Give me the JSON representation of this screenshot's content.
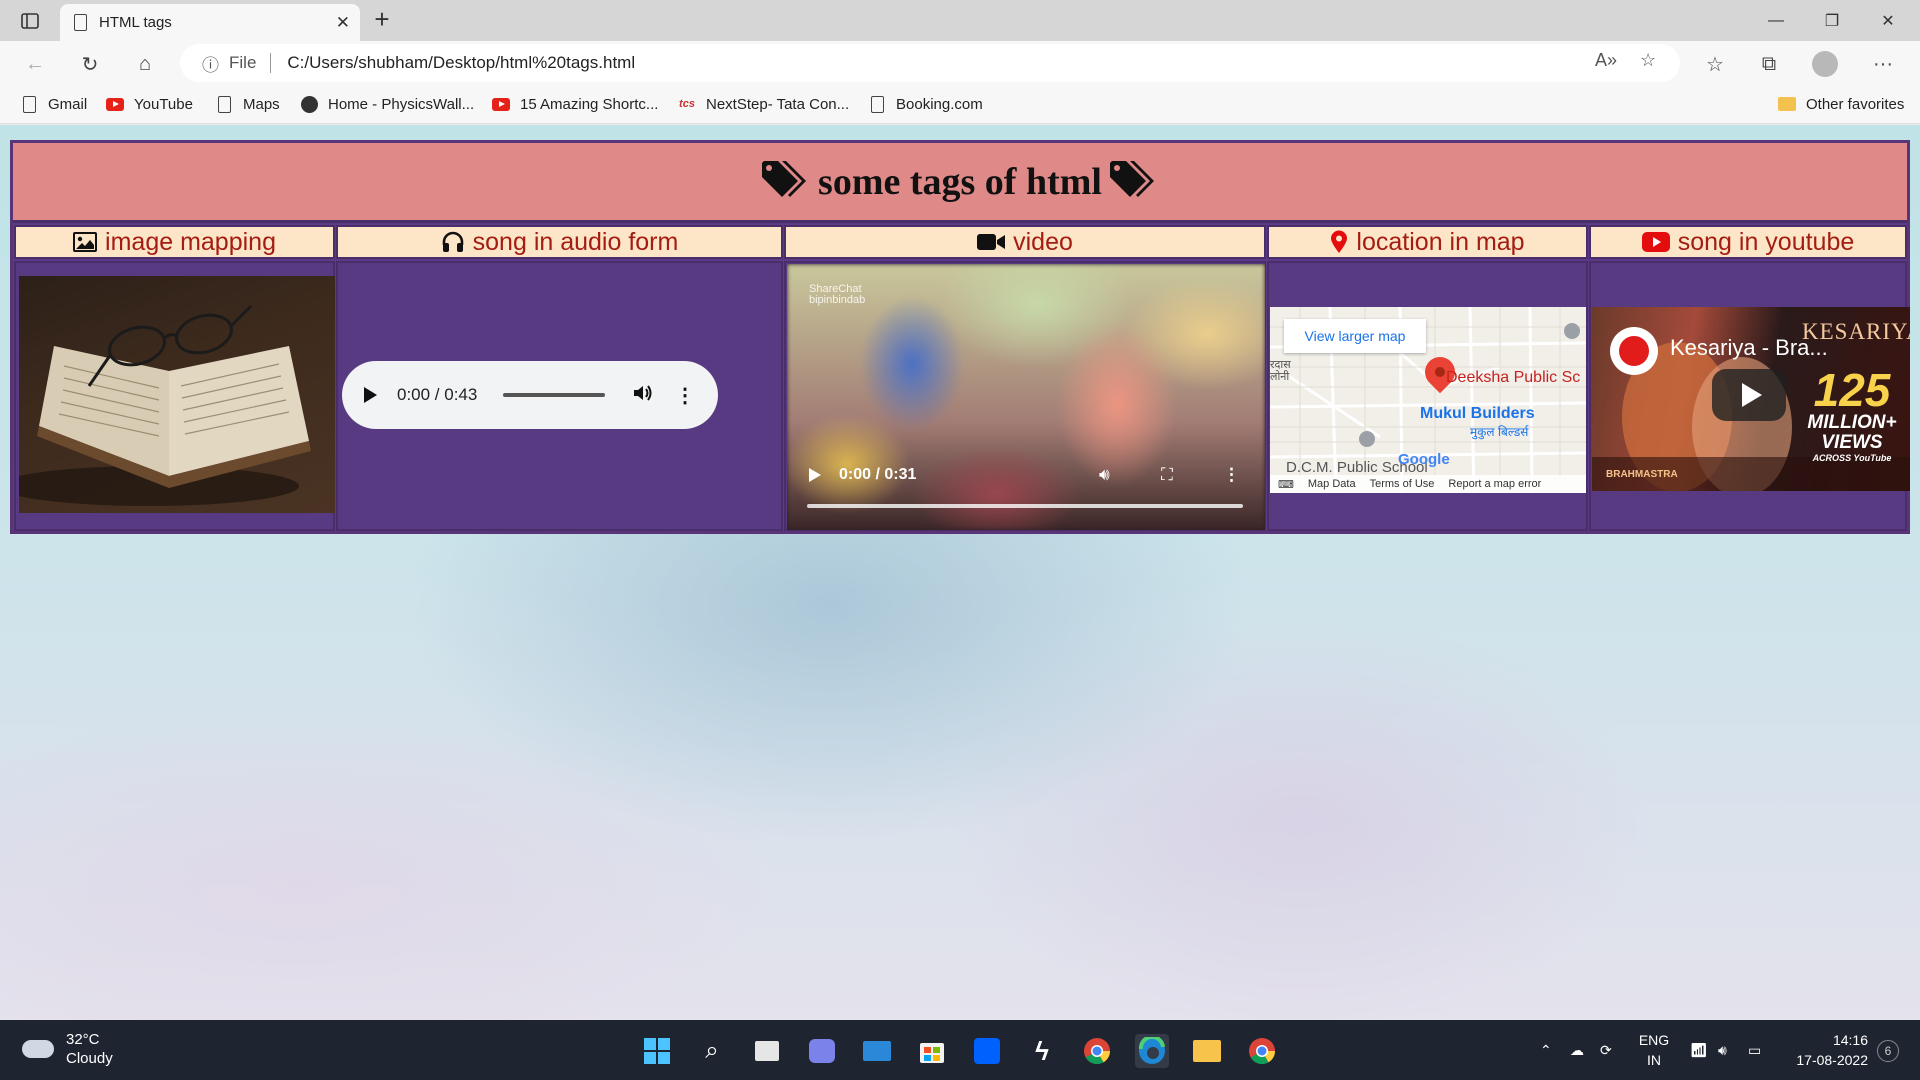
{
  "browser": {
    "tab_title": "HTML tags",
    "file_label": "File",
    "url": "C:/Users/shubham/Desktop/html%20tags.html",
    "favorites": [
      {
        "label": "Gmail",
        "icon": "page-icon"
      },
      {
        "label": "YouTube",
        "icon": "youtube-icon"
      },
      {
        "label": "Maps",
        "icon": "page-icon"
      },
      {
        "label": "Home - PhysicsWall...",
        "icon": "physicswallah-icon"
      },
      {
        "label": "15 Amazing Shortc...",
        "icon": "youtube-icon"
      },
      {
        "label": "NextStep- Tata Con...",
        "icon": "tcs-icon"
      },
      {
        "label": "Booking.com",
        "icon": "page-icon"
      }
    ],
    "other_favorites": "Other favorites"
  },
  "page": {
    "title": "some tags of html",
    "headers": [
      {
        "label": "image mapping",
        "icon": "image-icon"
      },
      {
        "label": "song in audio form",
        "icon": "headphones-icon"
      },
      {
        "label": "video",
        "icon": "video-camera-icon"
      },
      {
        "label": "location in map",
        "icon": "map-marker-icon"
      },
      {
        "label": "song in youtube",
        "icon": "youtube-icon"
      }
    ],
    "audio": {
      "time": "0:00 / 0:43"
    },
    "video": {
      "time": "0:00 / 0:31",
      "watermark": "ShareChat",
      "watermark_user": "bipinbindab"
    },
    "map": {
      "view_larger": "View larger map",
      "labels": [
        "Deeksha Public Sc",
        "Mukul Builders",
        "मुकुल बिल्डर्स",
        "D.C.M. Public School",
        "रदास",
        "लोनी"
      ],
      "footer": [
        "Map Data",
        "Terms of Use",
        "Report a map error"
      ],
      "brand": "Google"
    },
    "youtube": {
      "title": "Kesariya - Bra...",
      "overlay_title": "KESARIYA",
      "views_number": "125",
      "views_text": "MILLION+ VIEWS",
      "across": "ACROSS",
      "platform": "YouTube",
      "film": "BRAHMASTRA"
    }
  },
  "taskbar": {
    "weather_temp": "32°C",
    "weather_desc": "Cloudy",
    "lang_1": "ENG",
    "lang_2": "IN",
    "time": "14:16",
    "date": "17-08-2022",
    "notifications": "6"
  },
  "colors": {
    "title_bg": "#df8a88",
    "header_bg": "#fde5c7",
    "header_text": "#a31d12",
    "cell_bg": "#583a82"
  }
}
